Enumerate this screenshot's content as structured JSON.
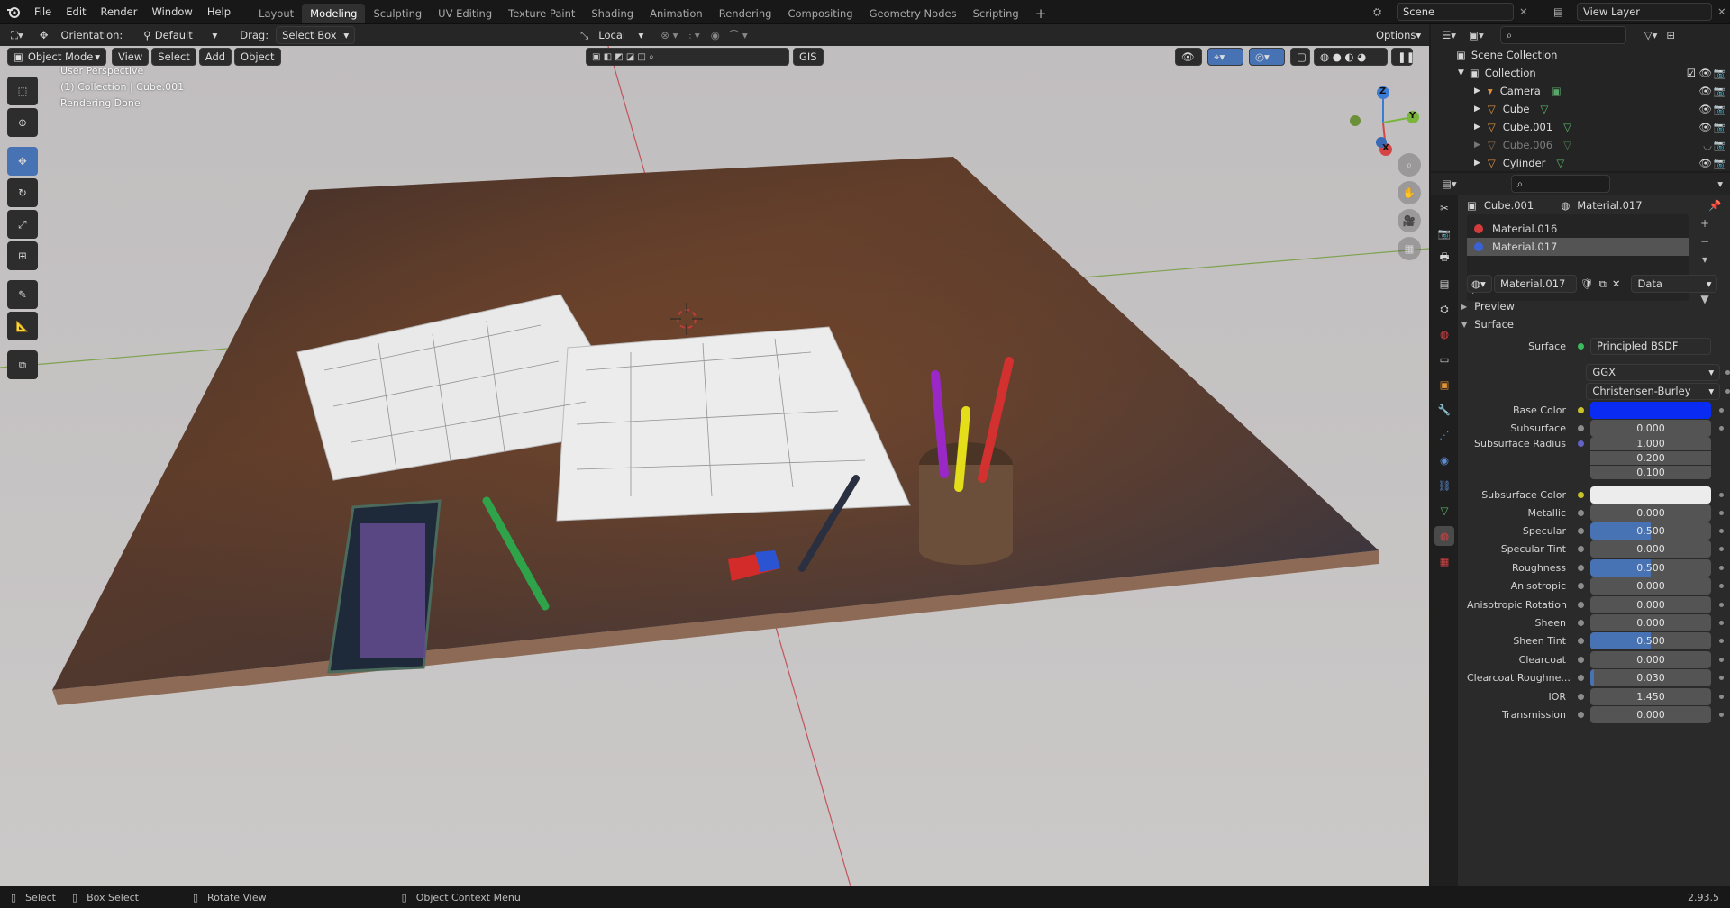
{
  "topbar": {
    "menus": [
      "File",
      "Edit",
      "Render",
      "Window",
      "Help"
    ],
    "workspaces": [
      "Layout",
      "Modeling",
      "Sculpting",
      "UV Editing",
      "Texture Paint",
      "Shading",
      "Animation",
      "Rendering",
      "Compositing",
      "Geometry Nodes",
      "Scripting"
    ],
    "active_workspace": "Modeling",
    "scene": "Scene",
    "view_layer": "View Layer"
  },
  "header": {
    "orientation_label": "Orientation:",
    "orientation_value": "Default",
    "drag_label": "Drag:",
    "drag_value": "Select Box",
    "pivot": "Local",
    "options": "Options"
  },
  "viewport_header": {
    "mode": "Object Mode",
    "menus": [
      "View",
      "Select",
      "Add",
      "Object"
    ],
    "gis": "GIS"
  },
  "overlay_text": {
    "line1": "User Perspective",
    "line2": "(1) Collection | Cube.001",
    "line3": "Rendering Done"
  },
  "axes": {
    "x": "X",
    "y": "Y",
    "z": "Z"
  },
  "outliner": {
    "scene_collection": "Scene Collection",
    "collection": "Collection",
    "items": [
      {
        "name": "Camera",
        "dim": false
      },
      {
        "name": "Cube",
        "dim": false
      },
      {
        "name": "Cube.001",
        "dim": false
      },
      {
        "name": "Cube.006",
        "dim": true
      },
      {
        "name": "Cylinder",
        "dim": false
      }
    ]
  },
  "properties": {
    "object": "Cube.001",
    "material": "Material.017",
    "slots": [
      "Material.016",
      "Material.017"
    ],
    "slot_colors": [
      "#d63b3b",
      "#3a62d6"
    ],
    "material_name": "Material.017",
    "link": "Data",
    "panels": {
      "preview": "Preview",
      "surface": "Surface"
    },
    "surface_label": "Surface",
    "surface_value": "Principled BSDF",
    "distribution": "GGX",
    "subsurface_method": "Christensen-Burley",
    "base_color_label": "Base Color",
    "base_color": "#0a2cf2",
    "subsurface_color": "#ececec",
    "rows": [
      {
        "label": "Subsurface",
        "value": "0.000",
        "fill": 0
      },
      {
        "label": "Subsurface Radius",
        "value": "1.000",
        "fill": 0
      },
      {
        "label": "",
        "value": "0.200",
        "fill": 0
      },
      {
        "label": "",
        "value": "0.100",
        "fill": 0
      }
    ],
    "subsurface_color_label": "Subsurface Color",
    "rows2": [
      {
        "label": "Metallic",
        "value": "0.000",
        "fill": 0
      },
      {
        "label": "Specular",
        "value": "0.500",
        "fill": 0.5
      },
      {
        "label": "Specular Tint",
        "value": "0.000",
        "fill": 0
      },
      {
        "label": "Roughness",
        "value": "0.500",
        "fill": 0.5
      },
      {
        "label": "Anisotropic",
        "value": "0.000",
        "fill": 0
      },
      {
        "label": "Anisotropic Rotation",
        "value": "0.000",
        "fill": 0
      },
      {
        "label": "Sheen",
        "value": "0.000",
        "fill": 0
      },
      {
        "label": "Sheen Tint",
        "value": "0.500",
        "fill": 0.5
      },
      {
        "label": "Clearcoat",
        "value": "0.000",
        "fill": 0
      },
      {
        "label": "Clearcoat Roughne...",
        "value": "0.030",
        "fill": 0.03
      },
      {
        "label": "IOR",
        "value": "1.450",
        "fill": 0
      },
      {
        "label": "Transmission",
        "value": "0.000",
        "fill": 0
      }
    ]
  },
  "statusbar": {
    "select": "Select",
    "box_select": "Box Select",
    "rotate": "Rotate View",
    "context": "Object Context Menu",
    "version": "2.93.5"
  }
}
